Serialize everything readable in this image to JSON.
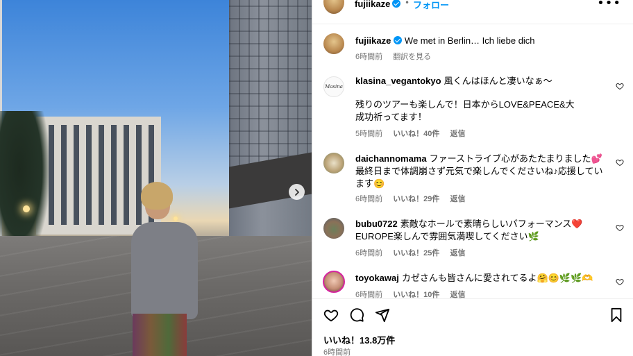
{
  "header": {
    "username": "fujiikaze",
    "dot": "•",
    "follow_label": "フォロー",
    "more_label": "•••"
  },
  "caption": {
    "username": "fujiikaze",
    "text": "We met in Berlin… Ich liebe dich",
    "time": "6時間前",
    "translate_label": "翻訳を見る"
  },
  "comments": [
    {
      "username": "klasina_vegantokyo",
      "avatar_text": "Masina",
      "text": "風くんはほんと凄いなぁ～",
      "text2": "残りのツアーも楽しんで！日本からLOVE&PEACE&大成功祈ってます！",
      "time": "5時間前",
      "likes": "いいね！40件",
      "reply": "返信"
    },
    {
      "username": "daichannomama",
      "text": "ファーストライブ心があたたまりました💕最終日まで体調崩さず元気で楽しんでくださいね♪応援しています😊",
      "time": "6時間前",
      "likes": "いいね！29件",
      "reply": "返信"
    },
    {
      "username": "bubu0722",
      "text": "素敵なホールで素晴らしいパフォーマンス❤️EUROPE楽しんで雰囲気満喫してください🌿",
      "time": "6時間前",
      "likes": "いいね！25件",
      "reply": "返信"
    },
    {
      "username": "toyokawaj",
      "text": "カゼさんも皆さんに愛されてるよ🤗😊🌿🌿🫶",
      "time": "6時間前",
      "likes": "いいね！10件",
      "reply": "返信"
    }
  ],
  "post": {
    "likes": "いいね！13.8万件",
    "time": "6時間前"
  },
  "colors": {
    "accent": "#0095f6",
    "muted": "#737373",
    "story_ring": "#d6249f"
  },
  "icons": [
    "verified-badge-icon",
    "heart-icon",
    "comment-icon",
    "share-icon",
    "bookmark-icon",
    "chevron-right-icon"
  ]
}
